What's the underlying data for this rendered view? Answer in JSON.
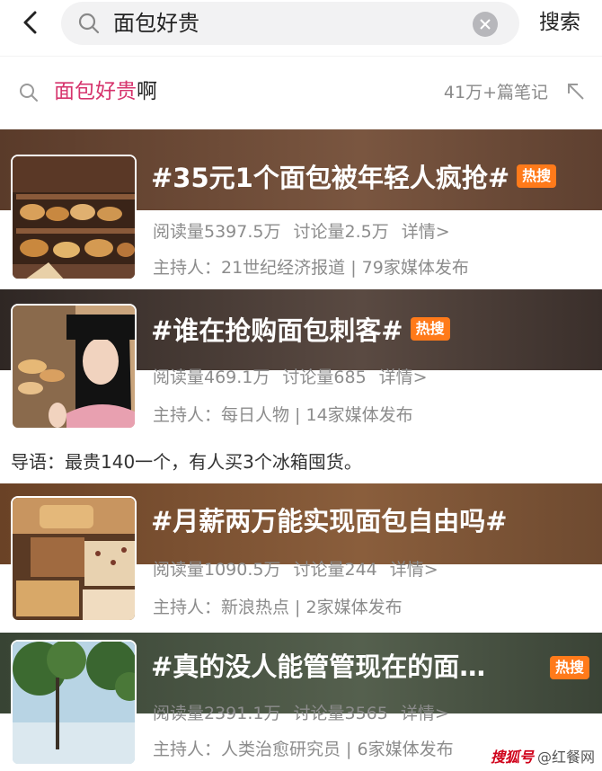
{
  "search": {
    "query": "面包好贵",
    "button_label": "搜索"
  },
  "suggestion": {
    "highlight": "面包好贵",
    "rest": "啊",
    "count": "41万+篇笔记"
  },
  "topics": [
    {
      "title": "#35元1个面包被年轻人疯抢#",
      "badge": "热搜",
      "reads": "阅读量5397.5万",
      "discuss": "讨论量2.5万",
      "details": "详情>",
      "host": "主持人：21世纪经济报道 | 79家媒体发布",
      "band_color": "#6b4a36"
    },
    {
      "title": "#谁在抢购面包刺客#",
      "badge": "热搜",
      "reads": "阅读量469.1万",
      "discuss": "讨论量685",
      "details": "详情>",
      "host": "主持人：每日人物 | 14家媒体发布",
      "band_color": "#4a3e3a"
    },
    {
      "title": "#月薪两万能实现面包自由吗#",
      "badge": "",
      "reads": "阅读量1090.5万",
      "discuss": "讨论量244",
      "details": "详情>",
      "host": "主持人：新浪热点 | 2家媒体发布",
      "band_color": "#7a4e2c"
    },
    {
      "title": "#真的没人能管管现在的面…",
      "badge": "热搜",
      "reads": "阅读量2391.1万",
      "discuss": "讨论量3565",
      "details": "详情>",
      "host": "主持人：人类治愈研究员 | 6家媒体发布",
      "band_color": "#3f4a3a"
    }
  ],
  "guide": "导语：最贵140一个，有人买3个冰箱囤货。",
  "watermark": {
    "logo": "搜狐号",
    "text": "@红餐网"
  },
  "colors": {
    "highlight": "#d6336c",
    "hot_badge": "#ff7a1a"
  }
}
